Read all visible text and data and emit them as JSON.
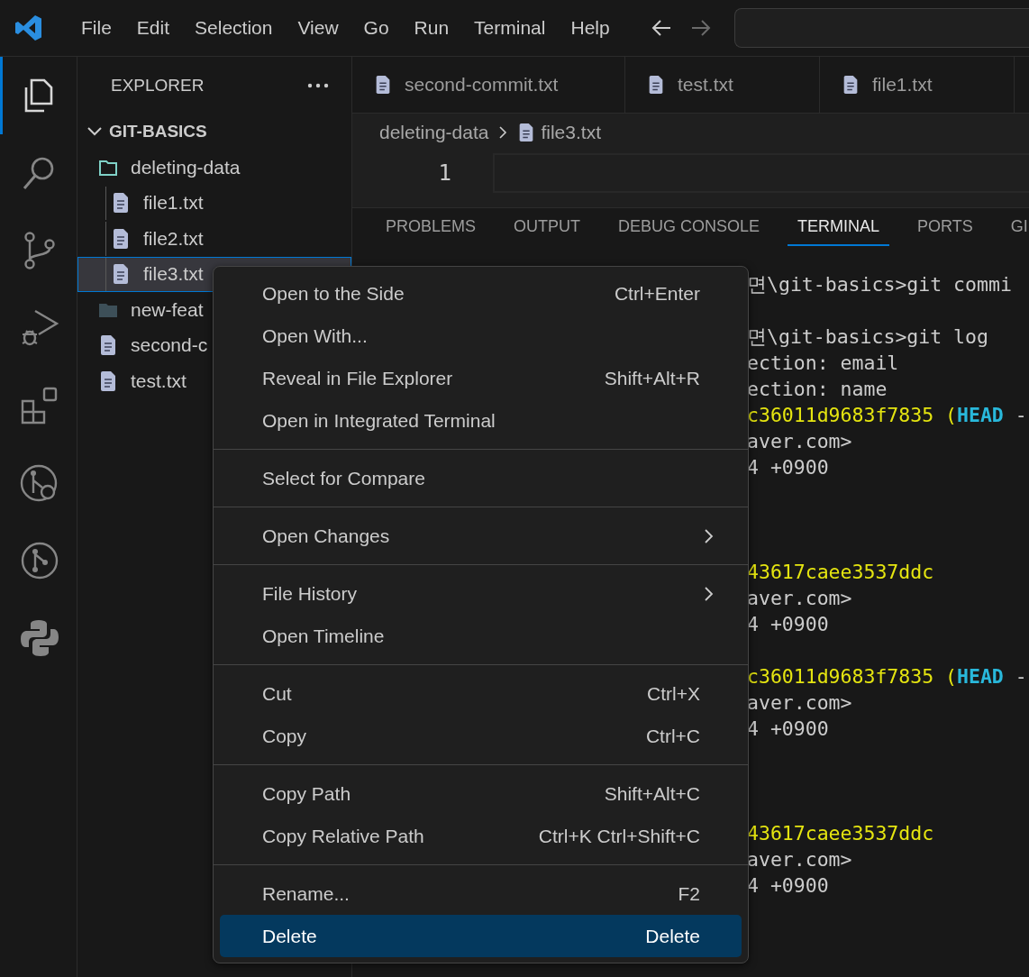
{
  "menu_bar": {
    "items": [
      "File",
      "Edit",
      "Selection",
      "View",
      "Go",
      "Run",
      "Terminal",
      "Help"
    ]
  },
  "activity_bar": {
    "items": [
      {
        "kind": "explorer",
        "selected": true
      },
      {
        "kind": "search",
        "selected": false
      },
      {
        "kind": "source-control",
        "selected": false
      },
      {
        "kind": "run-debug",
        "selected": false
      },
      {
        "kind": "extensions",
        "selected": false
      },
      {
        "kind": "git-search",
        "selected": false
      },
      {
        "kind": "git-circle",
        "selected": false
      },
      {
        "kind": "python",
        "selected": false
      }
    ]
  },
  "sidebar": {
    "title": "EXPLORER",
    "tree": {
      "label": "GIT-BASICS",
      "expanded": true,
      "children": [
        {
          "kind": "folder",
          "label": "deleting-data",
          "expanded": true,
          "selected": false,
          "children": [
            {
              "kind": "file",
              "label": "file1.txt",
              "selected": false
            },
            {
              "kind": "file",
              "label": "file2.txt",
              "selected": false
            },
            {
              "kind": "file",
              "label": "file3.txt",
              "selected": true
            }
          ]
        },
        {
          "kind": "folder",
          "label": "new-feat",
          "expanded": false,
          "selected": false
        },
        {
          "kind": "file",
          "label": "second-c",
          "selected": false
        },
        {
          "kind": "file",
          "label": "test.txt",
          "selected": false
        }
      ]
    }
  },
  "editor_tabs": [
    {
      "label": "second-commit.txt"
    },
    {
      "label": "test.txt"
    },
    {
      "label": "file1.txt"
    }
  ],
  "breadcrumb": [
    {
      "kind": "folder",
      "label": "deleting-data"
    },
    {
      "kind": "file",
      "label": "file3.txt"
    }
  ],
  "editor": {
    "line_numbers": [
      "1"
    ]
  },
  "panel_tabs": [
    {
      "label": "PROBLEMS",
      "selected": false
    },
    {
      "label": "OUTPUT",
      "selected": false
    },
    {
      "label": "DEBUG CONSOLE",
      "selected": false
    },
    {
      "label": "TERMINAL",
      "selected": true
    },
    {
      "label": "PORTS",
      "selected": false
    },
    {
      "label": "GI",
      "selected": false
    }
  ],
  "terminal": {
    "lines": [
      {
        "kind": "text",
        "segments": [
          {
            "kind": "plain",
            "text": "면\\git-basics>git commi"
          }
        ]
      },
      {
        "kind": "blank"
      },
      {
        "kind": "text",
        "segments": [
          {
            "kind": "plain",
            "text": "면\\git-basics>git log"
          }
        ]
      },
      {
        "kind": "text",
        "segments": [
          {
            "kind": "plain",
            "text": "ection: email"
          }
        ]
      },
      {
        "kind": "text",
        "segments": [
          {
            "kind": "plain",
            "text": "ection: name"
          }
        ]
      },
      {
        "kind": "text",
        "segments": [
          {
            "kind": "hash",
            "text": "c36011d9683f7835 ("
          },
          {
            "kind": "ref",
            "text": "HEAD"
          },
          {
            "kind": "plain",
            "text": " -"
          }
        ]
      },
      {
        "kind": "text",
        "segments": [
          {
            "kind": "plain",
            "text": "aver.com>"
          }
        ]
      },
      {
        "kind": "text",
        "segments": [
          {
            "kind": "plain",
            "text": "4 +0900"
          }
        ]
      },
      {
        "kind": "blank"
      },
      {
        "kind": "blank"
      },
      {
        "kind": "blank"
      },
      {
        "kind": "text",
        "segments": [
          {
            "kind": "hash",
            "text": "43617caee3537ddc"
          }
        ]
      },
      {
        "kind": "text",
        "segments": [
          {
            "kind": "plain",
            "text": "aver.com>"
          }
        ]
      },
      {
        "kind": "text",
        "segments": [
          {
            "kind": "plain",
            "text": "4 +0900"
          }
        ]
      },
      {
        "kind": "blank"
      },
      {
        "kind": "text",
        "segments": [
          {
            "kind": "hash",
            "text": "c36011d9683f7835 ("
          },
          {
            "kind": "ref",
            "text": "HEAD"
          },
          {
            "kind": "plain",
            "text": " -"
          }
        ]
      },
      {
        "kind": "text",
        "segments": [
          {
            "kind": "plain",
            "text": "aver.com>"
          }
        ]
      },
      {
        "kind": "text",
        "segments": [
          {
            "kind": "plain",
            "text": "4 +0900"
          }
        ]
      },
      {
        "kind": "blank"
      },
      {
        "kind": "blank"
      },
      {
        "kind": "blank"
      },
      {
        "kind": "text",
        "segments": [
          {
            "kind": "hash",
            "text": "43617caee3537ddc"
          }
        ]
      },
      {
        "kind": "text",
        "segments": [
          {
            "kind": "plain",
            "text": "aver.com>"
          }
        ]
      },
      {
        "kind": "text",
        "segments": [
          {
            "kind": "plain",
            "text": "4 +0900"
          }
        ]
      }
    ]
  },
  "context_menu": {
    "groups": [
      {
        "items": [
          {
            "label": "Open to the Side",
            "shortcut": "Ctrl+Enter",
            "submenu": false,
            "selected": false
          },
          {
            "label": "Open With...",
            "submenu": false,
            "selected": false
          },
          {
            "label": "Reveal in File Explorer",
            "shortcut": "Shift+Alt+R",
            "submenu": false,
            "selected": false
          },
          {
            "label": "Open in Integrated Terminal",
            "submenu": false,
            "selected": false
          }
        ]
      },
      {
        "items": [
          {
            "label": "Select for Compare",
            "submenu": false,
            "selected": false
          }
        ]
      },
      {
        "items": [
          {
            "label": "Open Changes",
            "submenu": true,
            "selected": false
          }
        ]
      },
      {
        "items": [
          {
            "label": "File History",
            "submenu": true,
            "selected": false
          },
          {
            "label": "Open Timeline",
            "submenu": false,
            "selected": false
          }
        ]
      },
      {
        "items": [
          {
            "label": "Cut",
            "shortcut": "Ctrl+X",
            "submenu": false,
            "selected": false
          },
          {
            "label": "Copy",
            "shortcut": "Ctrl+C",
            "submenu": false,
            "selected": false
          }
        ]
      },
      {
        "items": [
          {
            "label": "Copy Path",
            "shortcut": "Shift+Alt+C",
            "submenu": false,
            "selected": false
          },
          {
            "label": "Copy Relative Path",
            "shortcut": "Ctrl+K Ctrl+Shift+C",
            "submenu": false,
            "selected": false
          }
        ]
      },
      {
        "items": [
          {
            "label": "Rename...",
            "shortcut": "F2",
            "submenu": false,
            "selected": false
          },
          {
            "label": "Delete",
            "shortcut": "Delete",
            "submenu": false,
            "selected": true
          }
        ]
      }
    ]
  }
}
